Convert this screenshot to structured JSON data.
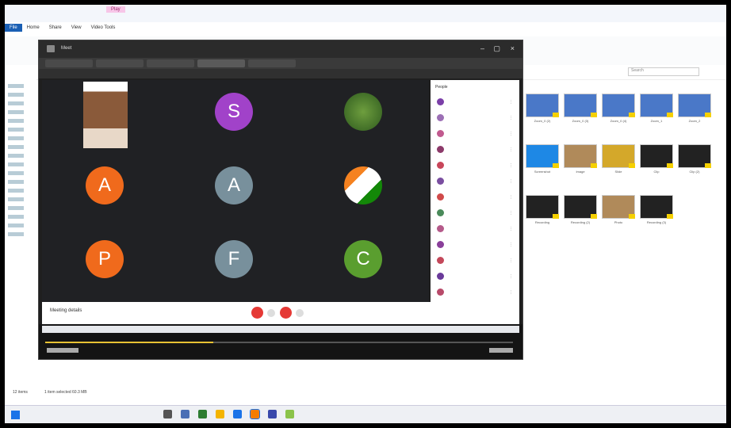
{
  "explorer": {
    "tabs": [
      "File",
      "Home",
      "Share",
      "View",
      "Video Tools"
    ],
    "manage_tab": "Play",
    "search_placeholder": "Search",
    "status_left": "12 items",
    "status_mid": "1 item selected  60.3 MB",
    "thumbnails": [
      {
        "caption": "Zoom_0 (2)",
        "kind": "video"
      },
      {
        "caption": "Zoom_0 (3)",
        "kind": "video"
      },
      {
        "caption": "Zoom_0 (4)",
        "kind": "video"
      },
      {
        "caption": "Zoom_1",
        "kind": "video"
      },
      {
        "caption": "Zoom_2",
        "kind": "video"
      },
      {
        "caption": "Screenshot",
        "kind": "blue"
      },
      {
        "caption": "Image",
        "kind": "photo"
      },
      {
        "caption": "Slide",
        "kind": "yellow"
      },
      {
        "caption": "Clip",
        "kind": "dark"
      },
      {
        "caption": "Clip (2)",
        "kind": "dark"
      },
      {
        "caption": "Recording",
        "kind": "dark"
      },
      {
        "caption": "Recording (2)",
        "kind": "dark"
      },
      {
        "caption": "Photo",
        "kind": "photo"
      },
      {
        "caption": "Recording (3)",
        "kind": "dark"
      }
    ]
  },
  "meeting": {
    "title": "Meet",
    "participants": [
      {
        "letter": "",
        "color": "#6b4a3a",
        "kind": "photo"
      },
      {
        "letter": "S",
        "color": "#a142c9",
        "kind": "letter"
      },
      {
        "letter": "",
        "color": "#4f7a2e",
        "kind": "photo"
      },
      {
        "letter": "A",
        "color": "#f06a1c",
        "kind": "letter"
      },
      {
        "letter": "A",
        "color": "#78909c",
        "kind": "letter"
      },
      {
        "letter": "",
        "color": "#c86b3a",
        "kind": "flag"
      },
      {
        "letter": "P",
        "color": "#f06a1c",
        "kind": "letter"
      },
      {
        "letter": "F",
        "color": "#78909c",
        "kind": "letter"
      },
      {
        "letter": "C",
        "color": "#5a9e2f",
        "kind": "letter"
      }
    ],
    "people_header": "People",
    "people_colors": [
      "#7b3fa8",
      "#9c6fb5",
      "#c15a8f",
      "#8c3a6a",
      "#c8465a",
      "#7a4ea0",
      "#d04a4a",
      "#4a8a5a",
      "#b55a8a",
      "#8a3f9a",
      "#c4485a",
      "#6a3a9a",
      "#b84a6a",
      "#9a5ab0",
      "#c05a5a"
    ],
    "controls_info": "Meeting details",
    "player_progress": 0.36
  },
  "colors": {
    "accent": "#1a73e8",
    "end_call": "#e53935"
  }
}
